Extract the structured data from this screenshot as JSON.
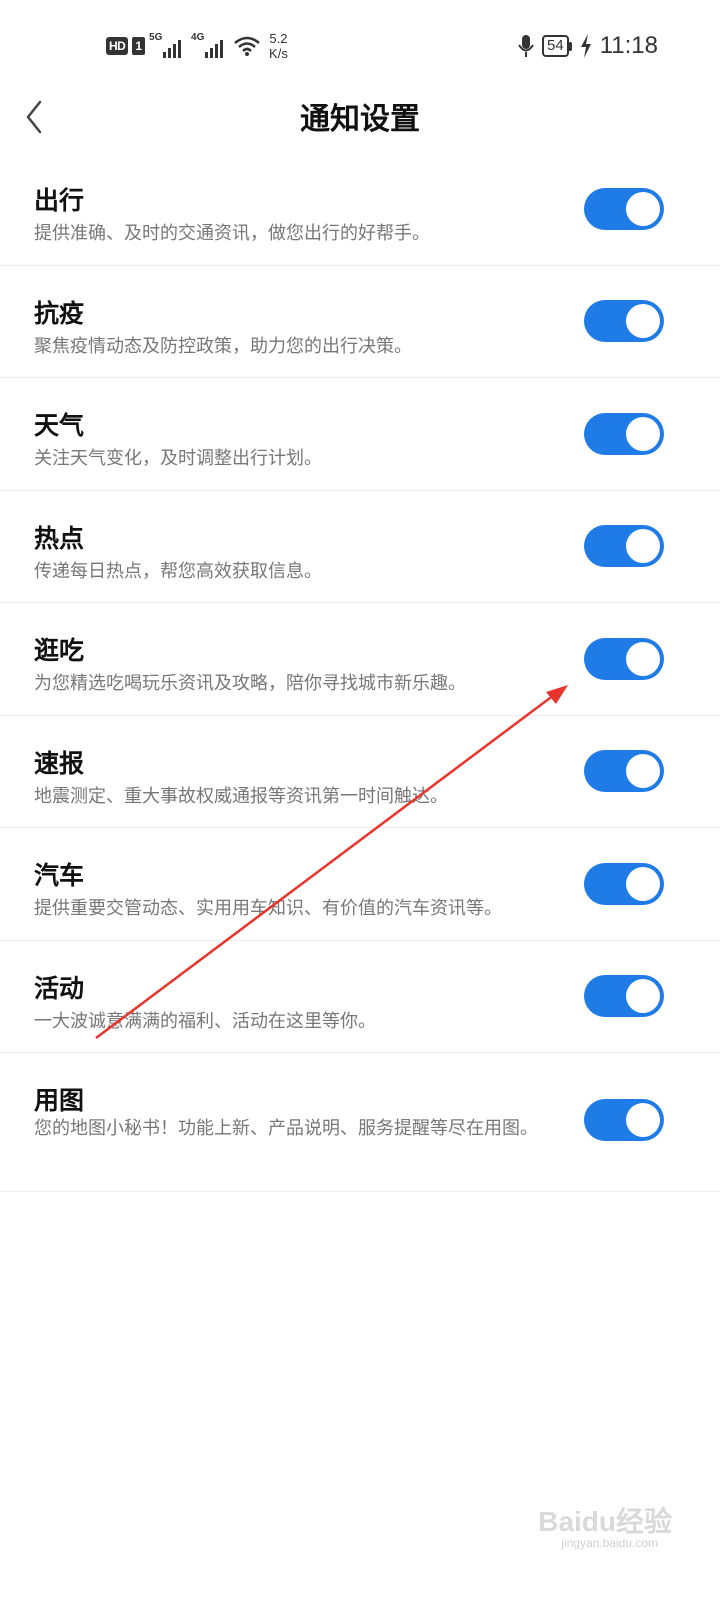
{
  "status_bar": {
    "hd": "HD",
    "sim": "1",
    "net1": "5G",
    "net2": "4G",
    "speed_value": "5.2",
    "speed_unit": "K/s",
    "battery": "54",
    "time": "11:18"
  },
  "header": {
    "title": "通知设置"
  },
  "items": [
    {
      "title": "出行",
      "desc": "提供准确、及时的交通资讯，做您出行的好帮手。",
      "enabled": true
    },
    {
      "title": "抗疫",
      "desc": "聚焦疫情动态及防控政策，助力您的出行决策。",
      "enabled": true
    },
    {
      "title": "天气",
      "desc": "关注天气变化，及时调整出行计划。",
      "enabled": true
    },
    {
      "title": "热点",
      "desc": "传递每日热点，帮您高效获取信息。",
      "enabled": true
    },
    {
      "title": "逛吃",
      "desc": "为您精选吃喝玩乐资讯及攻略，陪你寻找城市新乐趣。",
      "enabled": true
    },
    {
      "title": "速报",
      "desc": "地震测定、重大事故权威通报等资讯第一时间触达。",
      "enabled": true
    },
    {
      "title": "汽车",
      "desc": "提供重要交管动态、实用用车知识、有价值的汽车资讯等。",
      "enabled": true
    },
    {
      "title": "活动",
      "desc": "一大波诚意满满的福利、活动在这里等你。",
      "enabled": true
    },
    {
      "title": "用图",
      "desc": "您的地图小秘书！功能上新、产品说明、服务提醒等尽在用图。",
      "enabled": true
    }
  ],
  "watermark": {
    "brand": "Baidu经验",
    "url": "jingyan.baidu.com"
  },
  "colors": {
    "toggle_on": "#1f7be6",
    "annotation_arrow": "#e8342c"
  }
}
